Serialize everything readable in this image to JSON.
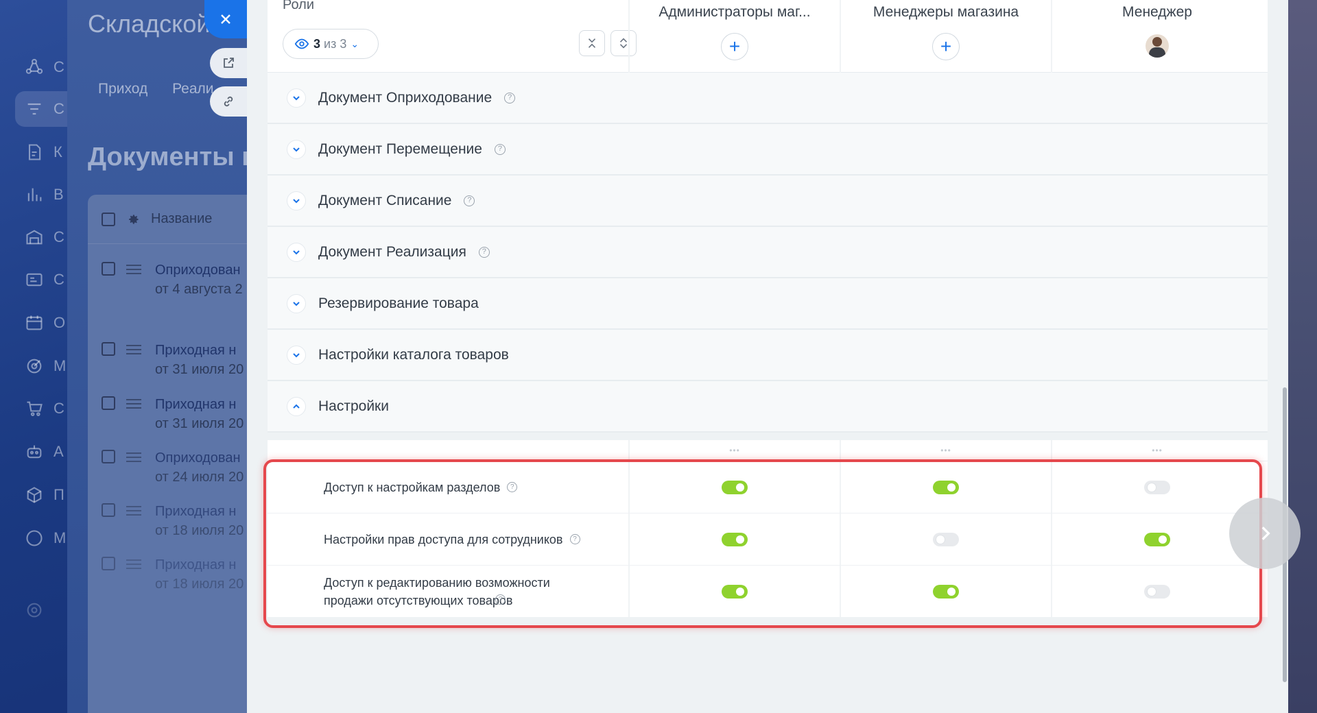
{
  "background": {
    "app_title": "Складской у",
    "tabs": [
      "Приход",
      "Реали"
    ],
    "page_heading": "Документы п",
    "table_header": "Название",
    "rail_letters": [
      "С",
      "С",
      "К",
      "В",
      "С",
      "С",
      "О",
      "М",
      "С",
      "А",
      "П",
      "М"
    ],
    "rows": [
      {
        "title": "Оприходован",
        "subtitle": "от 4 августа 2"
      },
      {
        "title": "Приходная н",
        "subtitle": "от 31 июля 20"
      },
      {
        "title": "Приходная н",
        "subtitle": "от 31 июля 20"
      },
      {
        "title": "Оприходован",
        "subtitle": "от 24 июля 20"
      },
      {
        "title": "Приходная н",
        "subtitle": "от 18 июля 20"
      },
      {
        "title": "Приходная н",
        "subtitle": "от 18 июля 20"
      }
    ]
  },
  "header": {
    "roles_label": "Роли",
    "roles_count": "3",
    "roles_of": "из 3",
    "columns": [
      "Администраторы маг...",
      "Менеджеры магазина",
      "Менеджер"
    ]
  },
  "sections": [
    {
      "label": "Документ Оприходование",
      "help": true
    },
    {
      "label": "Документ Перемещение",
      "help": true
    },
    {
      "label": "Документ Списание",
      "help": true
    },
    {
      "label": "Документ Реализация",
      "help": true
    },
    {
      "label": "Резервирование товара",
      "help": false
    },
    {
      "label": "Настройки каталога товаров",
      "help": false
    },
    {
      "label": "Настройки",
      "help": false
    }
  ],
  "permissions": [
    {
      "label": "Доступ к настройкам разделов",
      "values": [
        true,
        true,
        false
      ]
    },
    {
      "label": "Настройки прав доступа для сотрудников",
      "values": [
        true,
        false,
        true
      ]
    },
    {
      "label": "Доступ к редактированию возможности продажи отсутствующих товаров",
      "values": [
        true,
        true,
        false
      ]
    }
  ],
  "colors": {
    "accent": "#1a73e8",
    "toggle_on": "#8fd22e",
    "toggle_off": "#e8eaed",
    "highlight": "#e5484d"
  },
  "icons": {
    "close": "close-icon",
    "open_external": "external-link-icon",
    "copy_link": "link-icon",
    "eye": "eye-icon",
    "collapse_all": "collapse-icon",
    "expand_all": "expand-icon",
    "add": "plus-icon",
    "next": "chevron-right-icon",
    "help": "question-icon"
  }
}
